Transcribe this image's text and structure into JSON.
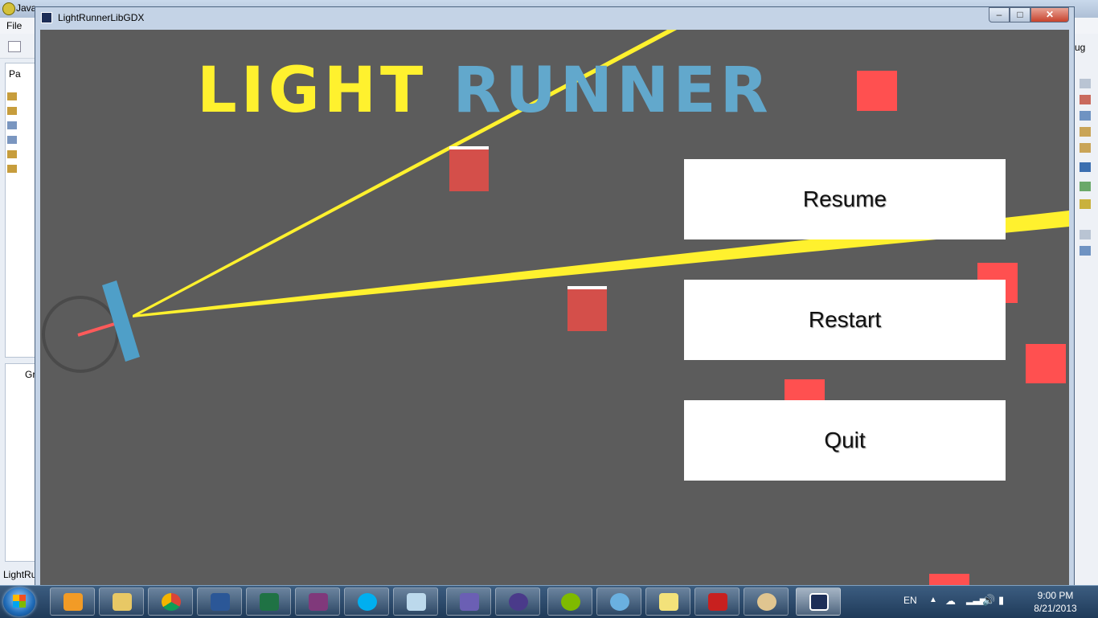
{
  "ide": {
    "title": "Java",
    "menu_file": "File",
    "left_tab_1": "Pa",
    "left_tab_2": "Gr",
    "status_text": "LightRu",
    "right_tab": "ug"
  },
  "window": {
    "title": "LightRunnerLibGDX",
    "min_glyph": "–",
    "max_glyph": "□",
    "close_glyph": "✕"
  },
  "game": {
    "logo_part1": "LIGHT",
    "logo_part2": "RUNNER",
    "colors": {
      "background": "#5c5c5c",
      "logo_yellow": "#fff12e",
      "logo_blue": "#62a8cc",
      "beam": "#fff12e",
      "block_red": "#ff5050",
      "block_dark_red": "#d44f4a",
      "mirror": "#4f9fc8",
      "player_ring": "#4a4a4a"
    },
    "menu": {
      "resume": "Resume",
      "restart": "Restart",
      "quit": "Quit"
    }
  },
  "taskbar": {
    "items": [
      "media-player",
      "explorer",
      "chrome",
      "word",
      "excel",
      "onenote",
      "skype",
      "notepad",
      "visual-studio",
      "eclipse",
      "brackets",
      "cat-app",
      "notes",
      "acrobat",
      "paint",
      "gdx-app"
    ],
    "tray": {
      "language": "EN",
      "time": "9:00 PM",
      "date": "8/21/2013"
    }
  }
}
